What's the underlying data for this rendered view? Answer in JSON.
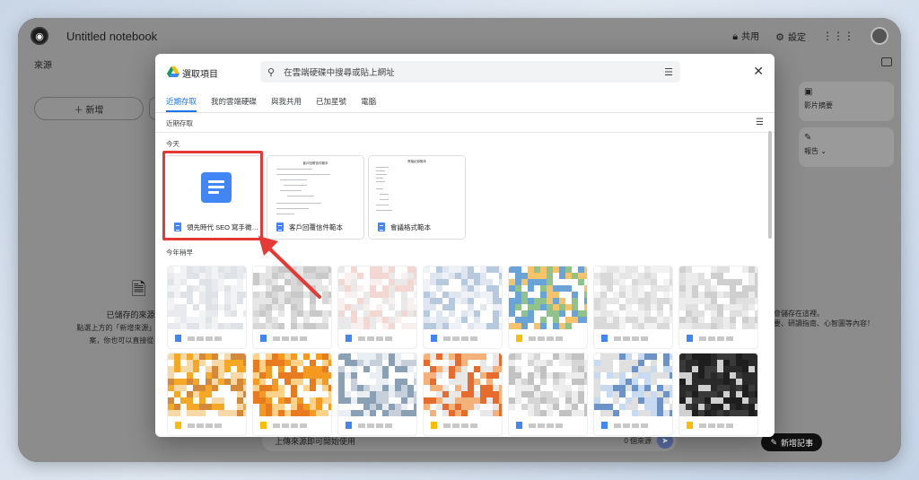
{
  "app": {
    "title": "Untitled notebook",
    "share_label": "共用",
    "settings_label": "設定",
    "sources_title": "來源",
    "add_source_label": "＋ 新增",
    "empty_sources": {
      "title": "已儲存的來源會顯",
      "desc_line1": "點選上方的「新增來源」即可新增 PDF",
      "desc_line2": "案，你也可以直接從 Google 文"
    },
    "chat_placeholder": "上傳來源即可開始使用",
    "chat_sources_count": "0 個來源",
    "studio": {
      "card1_label": "影片摘要",
      "card2_label": "報告",
      "note_line1": "的內容會儲存在這裡。",
      "note_line2": "語音摘要、研讀指南、心智圖等內容！"
    },
    "new_note_label": "新增記事"
  },
  "dialog": {
    "title": "選取項目",
    "search_placeholder": "在雲端硬碟中搜尋或貼上網址",
    "tabs": [
      "近期存取",
      "我的雲端硬碟",
      "與我共用",
      "已加星號",
      "電腦"
    ],
    "active_tab": 0,
    "section_label": "近期存取",
    "group_today": "今天",
    "group_earlier": "今年稍早",
    "today_files": [
      {
        "name": "領先時代 SEO 寫手徵…",
        "thumb_title": ""
      },
      {
        "name": "客戶回覆信件範本",
        "thumb_title": "客戶回覆信件範本"
      },
      {
        "name": "會議格式範本",
        "thumb_title": "會議紀錄範本"
      }
    ]
  },
  "colors": {
    "accent": "#1a73e8",
    "doc_blue": "#4285f4",
    "highlight": "#e53935"
  }
}
